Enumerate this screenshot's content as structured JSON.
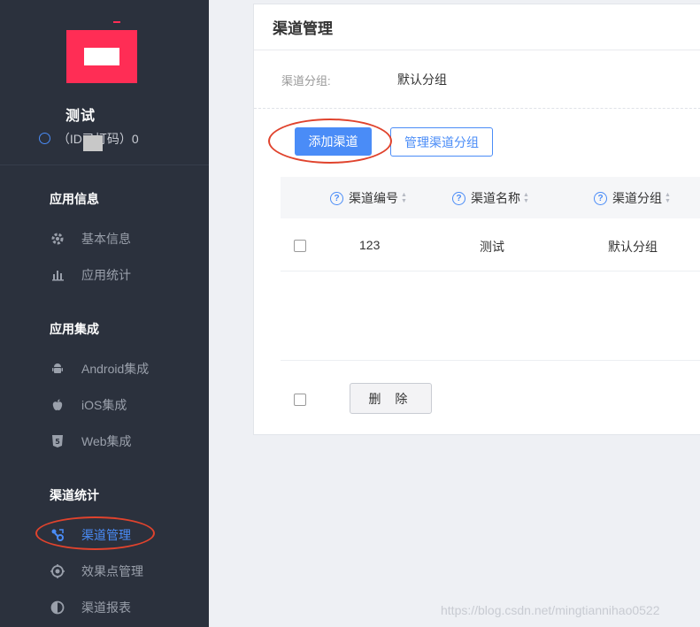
{
  "sidebar": {
    "app_name": "测试",
    "app_id": "（ID已打码）0",
    "sections": [
      {
        "title": "应用信息",
        "items": [
          {
            "label": "基本信息",
            "icon": "gear-icon"
          },
          {
            "label": "应用统计",
            "icon": "bar-chart-icon"
          }
        ]
      },
      {
        "title": "应用集成",
        "items": [
          {
            "label": "Android集成",
            "icon": "android-icon"
          },
          {
            "label": "iOS集成",
            "icon": "apple-icon"
          },
          {
            "label": "Web集成",
            "icon": "html5-icon"
          }
        ]
      },
      {
        "title": "渠道统计",
        "items": [
          {
            "label": "渠道管理",
            "icon": "channel-icon",
            "active": true
          },
          {
            "label": "效果点管理",
            "icon": "target-icon"
          },
          {
            "label": "渠道报表",
            "icon": "half-circle-icon"
          }
        ]
      }
    ]
  },
  "main": {
    "title": "渠道管理",
    "filter": {
      "label": "渠道分组:",
      "value": "默认分组"
    },
    "buttons": {
      "add": "添加渠道",
      "manage_groups": "管理渠道分组",
      "delete": "删 除"
    },
    "table": {
      "columns": [
        "渠道编号",
        "渠道名称",
        "渠道分组"
      ],
      "rows": [
        {
          "id": "123",
          "name": "测试",
          "group": "默认分组"
        }
      ]
    }
  },
  "watermark": "https://blog.csdn.net/mingtiannihao0522",
  "colors": {
    "sidebar_bg": "#2b313d",
    "accent": "#4a8cf7",
    "annotation": "#e0432d",
    "logo": "#ff2d55"
  }
}
